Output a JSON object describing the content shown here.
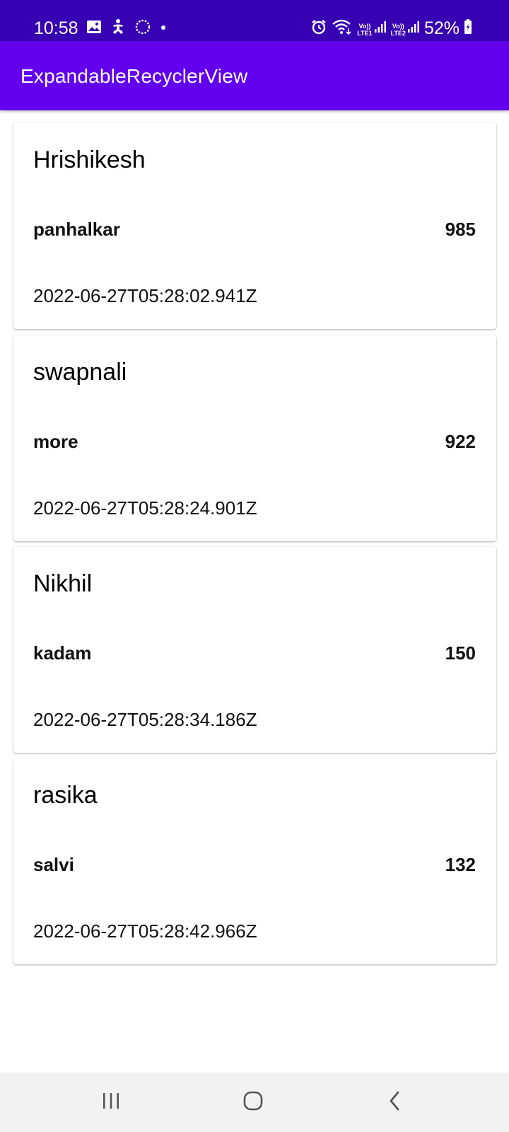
{
  "status_bar": {
    "time": "10:58",
    "battery_percent": "52%",
    "sim1_label": "LTE1",
    "sim2_label": "LTE2",
    "volte_label": "Vo))",
    "icons": [
      "image-icon",
      "accessibility-icon",
      "sync-icon",
      "dot-icon",
      "alarm-icon",
      "wifi-icon",
      "signal-icon",
      "battery-icon"
    ]
  },
  "app_bar": {
    "title": "ExpandableRecyclerView",
    "color": "#6200ee"
  },
  "items": [
    {
      "name": "Hrishikesh",
      "surname": "panhalkar",
      "number": "985",
      "timestamp": "2022-06-27T05:28:02.941Z"
    },
    {
      "name": "swapnali",
      "surname": "more",
      "number": "922",
      "timestamp": "2022-06-27T05:28:24.901Z"
    },
    {
      "name": "Nikhil",
      "surname": "kadam",
      "number": "150",
      "timestamp": "2022-06-27T05:28:34.186Z"
    },
    {
      "name": "rasika",
      "surname": "salvi",
      "number": "132",
      "timestamp": "2022-06-27T05:28:42.966Z"
    }
  ],
  "nav_bar": {
    "buttons": [
      "recents-icon",
      "home-icon",
      "back-icon"
    ]
  }
}
